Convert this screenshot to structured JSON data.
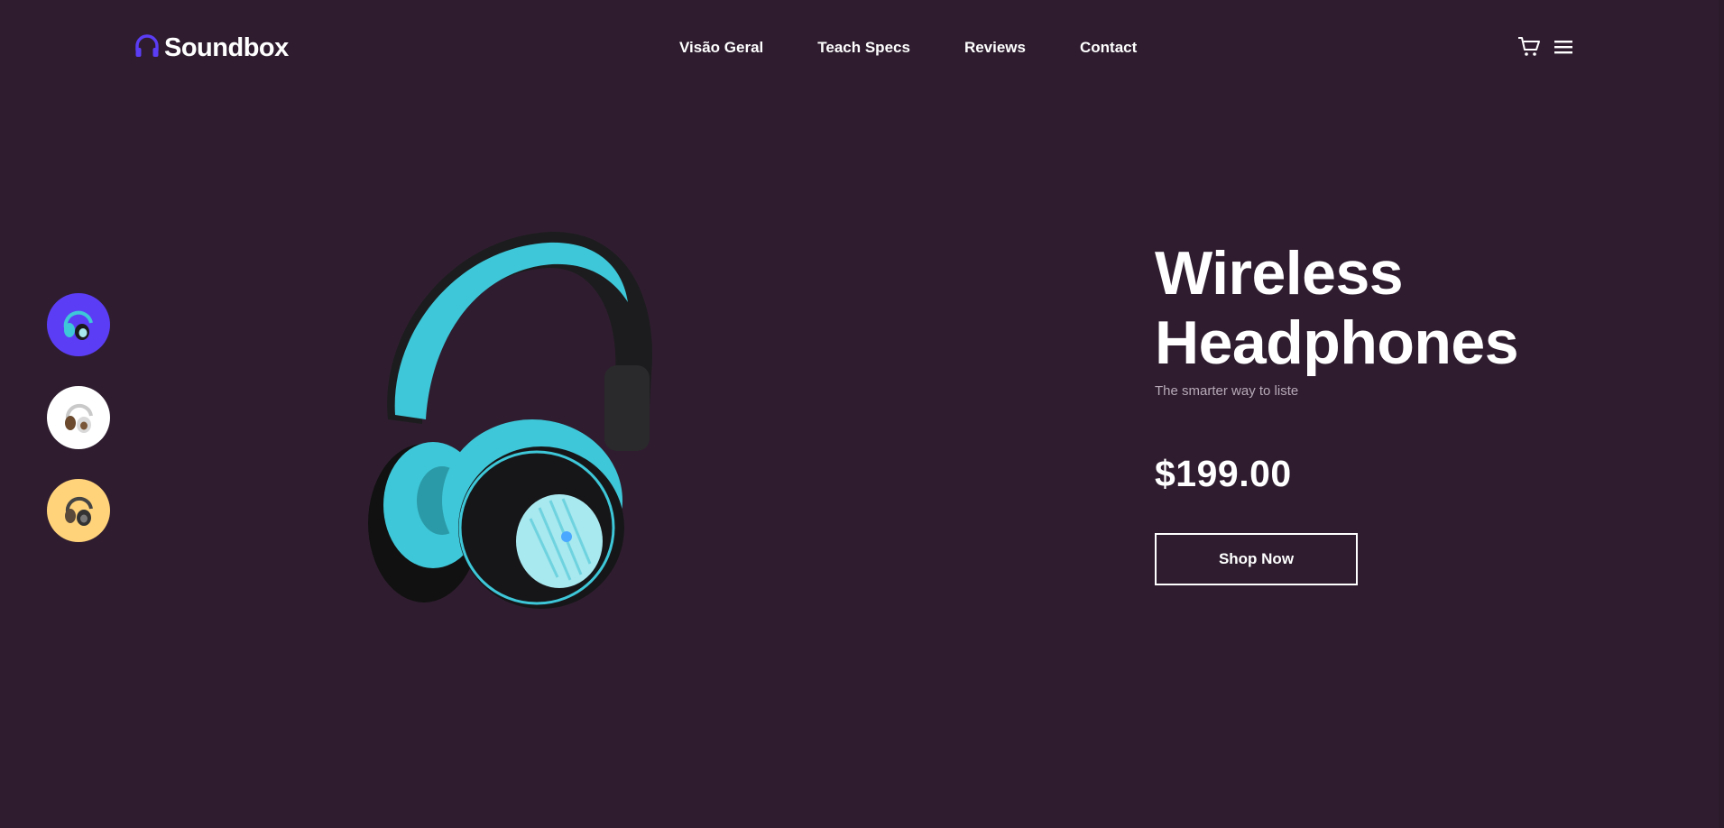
{
  "brand": {
    "name": "Soundbox",
    "icon": "headphones-icon",
    "accent": "#5b3df5"
  },
  "nav": {
    "items": [
      {
        "label": "Visão Geral"
      },
      {
        "label": "Teach Specs"
      },
      {
        "label": "Reviews"
      },
      {
        "label": "Contact"
      }
    ]
  },
  "header_icons": [
    "cart-icon",
    "menu-icon"
  ],
  "thumbnails": [
    {
      "name": "blue headphones",
      "bg": "#5b3df5"
    },
    {
      "name": "white headphones",
      "bg": "#ffffff"
    },
    {
      "name": "dark headphones",
      "bg": "#ffd37a"
    }
  ],
  "hero": {
    "title_line1": "Wireless",
    "title_line2": "Headphones",
    "subtitle": "The smarter way to liste",
    "price": "$199.00",
    "cta": "Shop Now"
  },
  "colors": {
    "background": "#2f1d2f",
    "accent": "#5b3df5",
    "product": "#3ec7d8"
  }
}
